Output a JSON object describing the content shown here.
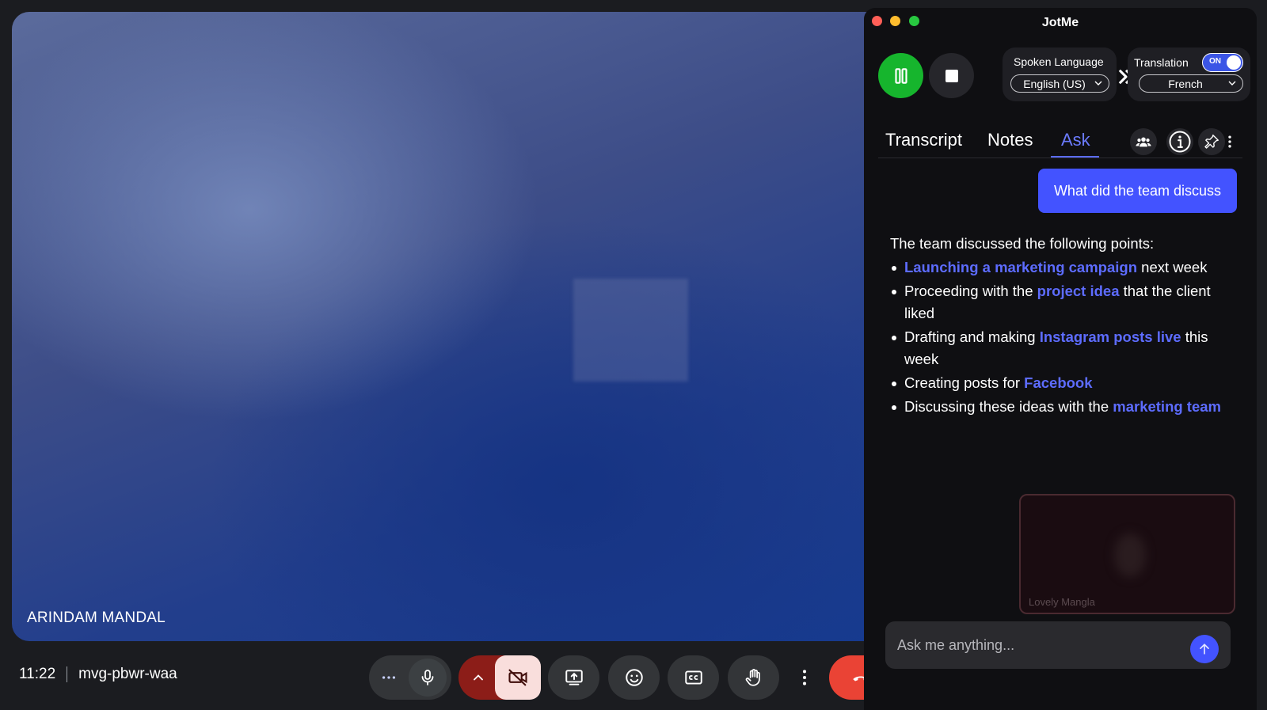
{
  "meet": {
    "participant_name": "ARINDAM MANDAL",
    "time": "11:22",
    "meeting_code": "mvg-pbwr-waa",
    "controls": [
      {
        "icon": "more-horiz-icon"
      },
      {
        "icon": "microphone-icon"
      },
      {
        "icon": "chevron-up-icon"
      },
      {
        "icon": "camera-off-icon"
      },
      {
        "icon": "present-screen-icon"
      },
      {
        "icon": "emoji-icon"
      },
      {
        "icon": "captions-icon"
      },
      {
        "icon": "raise-hand-icon"
      },
      {
        "icon": "more-vert-icon"
      },
      {
        "icon": "hangup-icon"
      }
    ]
  },
  "jotme": {
    "title": "JotMe",
    "spoken_language_label": "Spoken Language",
    "spoken_language_value": "English (US)",
    "translation_label": "Translation",
    "translation_toggle": "ON",
    "translation_language": "French",
    "tabs": [
      "Transcript",
      "Notes",
      "Ask"
    ],
    "active_tab": "Ask",
    "question": "What did the team discuss",
    "answer_intro": "The team discussed the following points:",
    "answer_points": [
      {
        "parts": [
          {
            "t": "Launching a marketing campaign",
            "hl": true
          },
          {
            "t": " next week",
            "hl": false
          }
        ]
      },
      {
        "parts": [
          {
            "t": "Proceeding with the ",
            "hl": false
          },
          {
            "t": "project idea",
            "hl": true
          },
          {
            "t": " that the client liked",
            "hl": false
          }
        ]
      },
      {
        "parts": [
          {
            "t": "Drafting and making ",
            "hl": false
          },
          {
            "t": "Instagram posts live",
            "hl": true
          },
          {
            "t": " this week",
            "hl": false
          }
        ]
      },
      {
        "parts": [
          {
            "t": "Creating posts for ",
            "hl": false
          },
          {
            "t": "Facebook",
            "hl": true
          }
        ]
      },
      {
        "parts": [
          {
            "t": "Discussing these ideas with the ",
            "hl": false
          },
          {
            "t": "marketing team",
            "hl": true
          }
        ]
      }
    ],
    "pip_name": "Lovely Mangla",
    "ask_placeholder": "Ask me anything...",
    "colors": {
      "accent": "#4353ff",
      "record_green": "#16b52d"
    }
  }
}
